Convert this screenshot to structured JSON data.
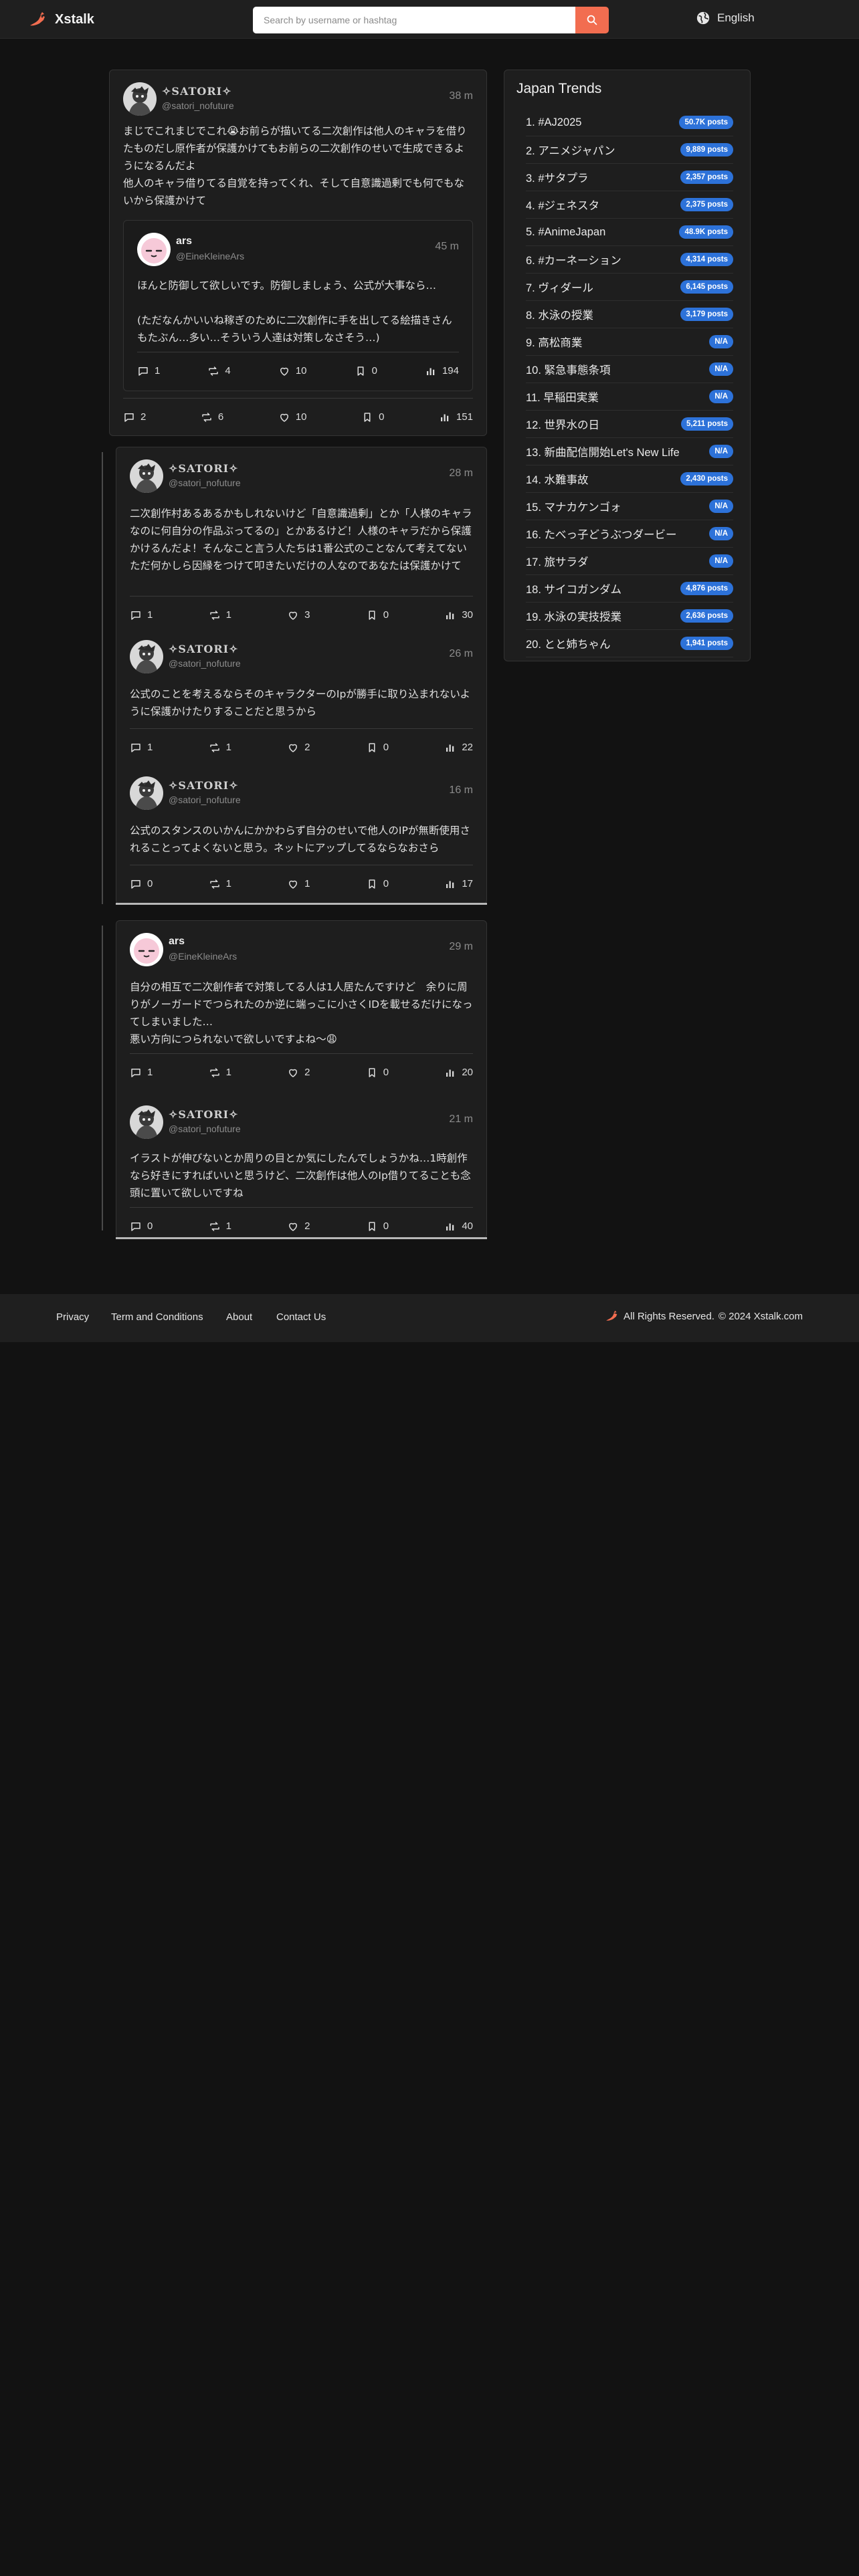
{
  "header": {
    "brand": "Xstalk",
    "search_placeholder": "Search by username or hashtag",
    "language": "English"
  },
  "colors": {
    "background": "#121212",
    "card": "#1e1e1e",
    "accent": "#f26d50",
    "badge": "#2d72d9"
  },
  "feed": {
    "post1": {
      "name": "✧SATORI✧",
      "handle": "@satori_nofuture",
      "time": "38 m",
      "text": "まじでこれまじでこれ😭お前らが描いてる二次創作は他人のキャラを借りたものだし原作者が保護かけてもお前らの二次創作のせいで生成できるようになるんだよ\n他人のキャラ借りてる自覚を持ってくれ、そして自意識過剰でも何でもないから保護かけて",
      "quote": {
        "name": "ars",
        "handle": "@EineKleineArs",
        "time": "45 m",
        "text": "ほんと防御して欲しいです。防御しましょう、公式が大事なら…\n\n(ただなんかいいね稼ぎのために二次創作に手を出してる絵描きさんもたぶん…多い…そういう人達は対策しなさそう…)",
        "replies": "1",
        "reposts": "4",
        "likes": "10",
        "bookmarks": "0",
        "views": "194"
      },
      "replies": "2",
      "reposts": "6",
      "likes": "10",
      "bookmarks": "0",
      "views": "151"
    },
    "thread1": [
      {
        "name": "✧SATORI✧",
        "handle": "@satori_nofuture",
        "time": "28 m",
        "text": "二次創作村あるあるかもしれないけど「自意識過剰」とか「人様のキャラなのに何自分の作品ぶってるの」とかあるけど！人様のキャラだから保護かけるんだよ！そんなこと言う人たちは1番公式のことなんて考えてないただ何かしら因縁をつけて叩きたいだけの人なのであなたは保護かけて",
        "replies": "1",
        "reposts": "1",
        "likes": "3",
        "bookmarks": "0",
        "views": "30"
      },
      {
        "name": "✧SATORI✧",
        "handle": "@satori_nofuture",
        "time": "26 m",
        "text": "公式のことを考えるならそのキャラクターのIpが勝手に取り込まれないように保護かけたりすることだと思うから",
        "replies": "1",
        "reposts": "1",
        "likes": "2",
        "bookmarks": "0",
        "views": "22"
      },
      {
        "name": "✧SATORI✧",
        "handle": "@satori_nofuture",
        "time": "16 m",
        "text": "公式のスタンスのいかんにかかわらず自分のせいで他人のIPが無断使用されることってよくないと思う。ネットにアップしてるならなおさら",
        "replies": "0",
        "reposts": "1",
        "likes": "1",
        "bookmarks": "0",
        "views": "17"
      }
    ],
    "thread2": [
      {
        "name": "ars",
        "handle": "@EineKleineArs",
        "time": "29 m",
        "text": "自分の相互で二次創作者で対策してる人は1人居たんですけど　余りに周りがノーガードでつられたのか逆に端っこに小さくIDを載せるだけになってしまいました…\n悪い方向につられないで欲しいですよね〜😩",
        "replies": "1",
        "reposts": "1",
        "likes": "2",
        "bookmarks": "0",
        "views": "20"
      },
      {
        "name": "✧SATORI✧",
        "handle": "@satori_nofuture",
        "time": "21 m",
        "text": "イラストが伸びないとか周りの目とか気にしたんでしょうかね…1時創作なら好きにすればいいと思うけど、二次創作は他人のIp借りてることも念頭に置いて欲しいですね",
        "replies": "0",
        "reposts": "1",
        "likes": "2",
        "bookmarks": "0",
        "views": "40"
      }
    ]
  },
  "trends": {
    "title": "Japan Trends",
    "items": [
      {
        "label": "1. #AJ2025",
        "count": "50.7K posts"
      },
      {
        "label": "2. アニメジャパン",
        "count": "9,889 posts"
      },
      {
        "label": "3. #サタプラ",
        "count": "2,357 posts"
      },
      {
        "label": "4. #ジェネスタ",
        "count": "2,375 posts"
      },
      {
        "label": "5. #AnimeJapan",
        "count": "48.9K posts"
      },
      {
        "label": "6. #カーネーション",
        "count": "4,314 posts"
      },
      {
        "label": "7. ヴィダール",
        "count": "6,145 posts"
      },
      {
        "label": "8. 水泳の授業",
        "count": "3,179 posts"
      },
      {
        "label": "9. 高松商業",
        "count": "N/A"
      },
      {
        "label": "10. 緊急事態条項",
        "count": "N/A"
      },
      {
        "label": "11. 早稲田実業",
        "count": "N/A"
      },
      {
        "label": "12. 世界水の日",
        "count": "5,211 posts"
      },
      {
        "label": "13. 新曲配信開始Let's New Life",
        "count": "N/A"
      },
      {
        "label": "14. 水難事故",
        "count": "2,430 posts"
      },
      {
        "label": "15. マナカケンゴォ",
        "count": "N/A"
      },
      {
        "label": "16. たべっ子どうぶつダービー",
        "count": "N/A"
      },
      {
        "label": "17. 旅サラダ",
        "count": "N/A"
      },
      {
        "label": "18. サイコガンダム",
        "count": "4,876 posts"
      },
      {
        "label": "19. 水泳の実技授業",
        "count": "2,636 posts"
      },
      {
        "label": "20. とと姉ちゃん",
        "count": "1,941 posts"
      }
    ]
  },
  "footer": {
    "privacy": "Privacy",
    "terms": "Term and Conditions",
    "about": "About",
    "contact": "Contact Us",
    "rights": "All Rights Reserved.",
    "copyright": "© 2024 Xstalk.com"
  }
}
